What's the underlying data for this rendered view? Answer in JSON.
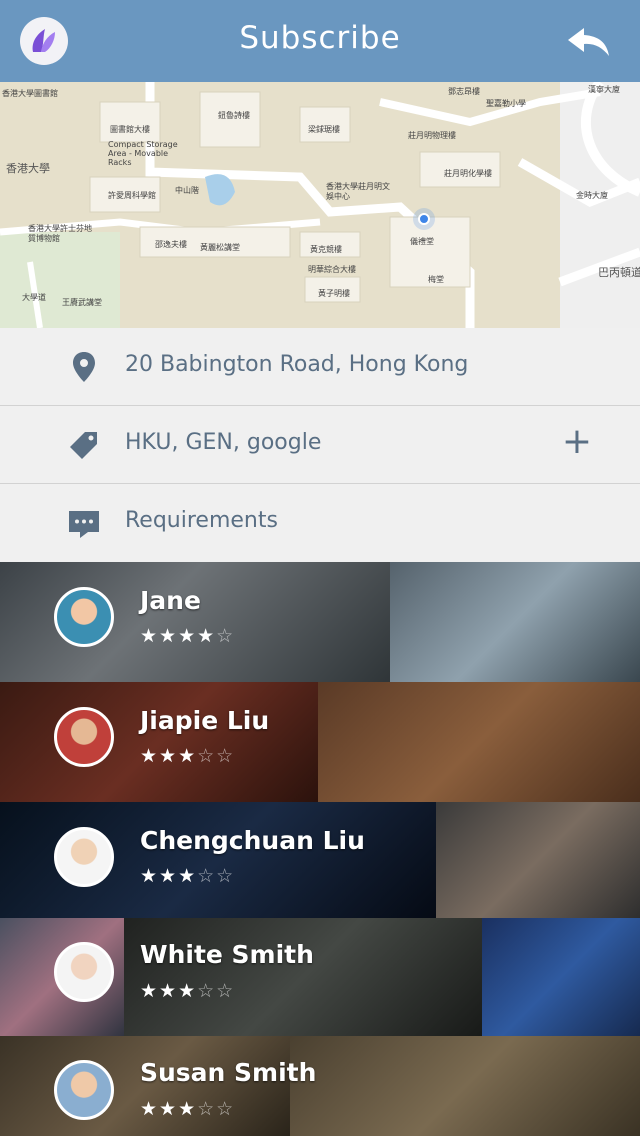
{
  "header": {
    "title": "Subscribe",
    "logo_icon": "app-logo",
    "back_icon": "reply-arrow-icon",
    "bg_color": "#6a97c0"
  },
  "map": {
    "labels": [
      "香港大學圖書館",
      "圖書館大樓",
      "Compact Storage Area - Movable Racks",
      "許愛周科學館",
      "香港大學許士芬地質博物館",
      "邵逸夫樓",
      "黃麗松講堂",
      "鈕魯詩樓",
      "梁銶琚樓",
      "莊月明物理樓",
      "莊月明化學樓",
      "香港大學莊月明文娛中心",
      "儀禮堂",
      "梅堂",
      "黃克競樓",
      "明華綜合大樓",
      "黃子明樓",
      "香港大學",
      "巴丙頓道",
      "金時大廈",
      "聖嘉勒小學",
      "漢寧大廈",
      "鄧志昂樓",
      "中山階",
      "大學道",
      "王賡武講堂"
    ]
  },
  "info": {
    "address": "20 Babington Road, Hong Kong",
    "tags": "HKU, GEN, google",
    "requirements": "Requirements",
    "location_icon": "location-pin-icon",
    "tag_icon": "tag-icon",
    "comment_icon": "comment-icon",
    "add_icon": "plus-icon",
    "text_color": "#5a6f84"
  },
  "people": [
    {
      "name": "Jane",
      "rating": 4,
      "stars": "★★★★",
      "empty": "☆"
    },
    {
      "name": "Jiapie Liu",
      "rating": 3,
      "stars": "★★★",
      "empty": "☆☆"
    },
    {
      "name": "Chengchuan Liu",
      "rating": 3,
      "stars": "★★★",
      "empty": "☆☆"
    },
    {
      "name": "White Smith",
      "rating": 3,
      "stars": "★★★",
      "empty": "☆☆"
    },
    {
      "name": "Susan Smith",
      "rating": 3,
      "stars": "★★★",
      "empty": "☆☆"
    }
  ]
}
